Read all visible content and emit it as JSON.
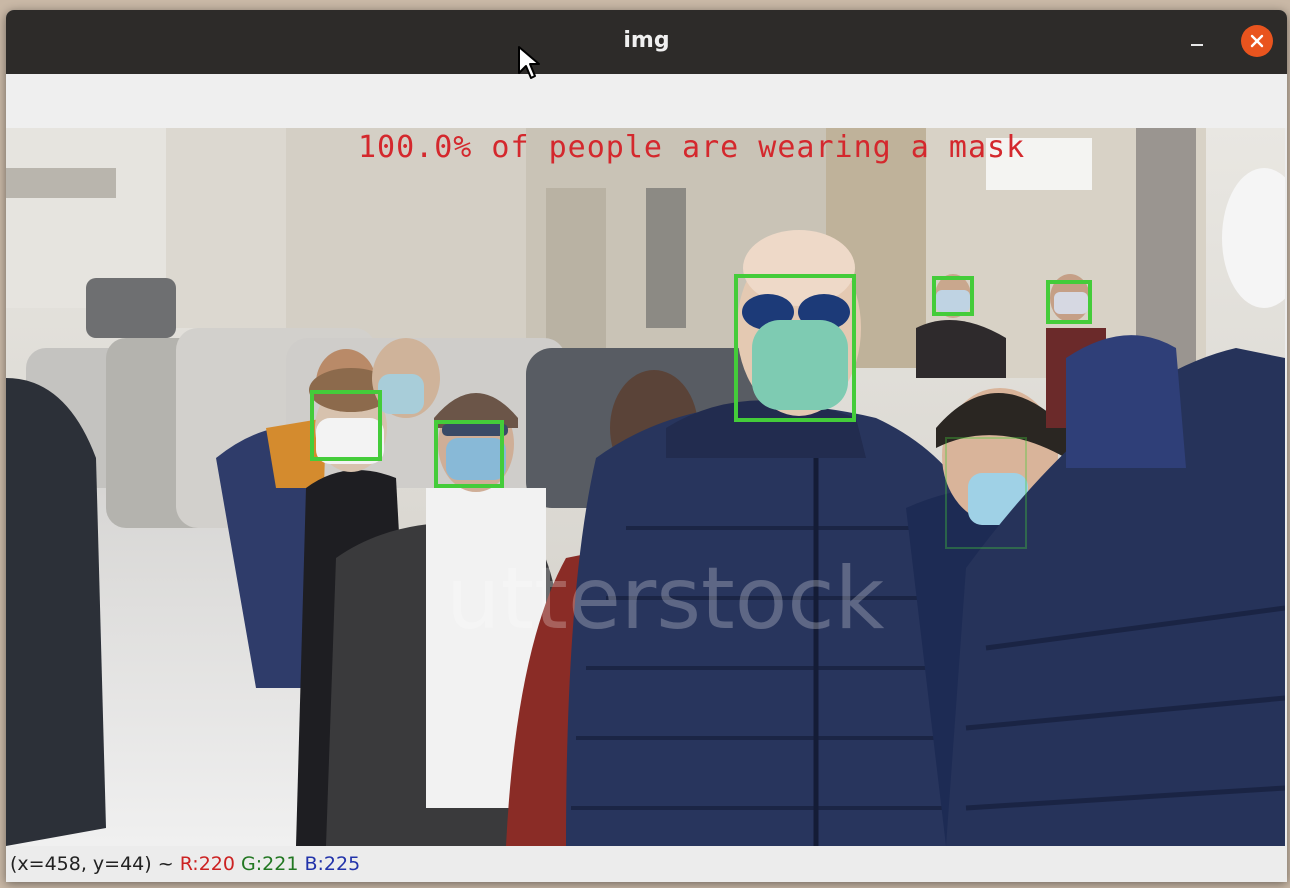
{
  "window": {
    "title": "img"
  },
  "overlay": {
    "text": "100.0% of people are wearing a mask",
    "color": "#d4282d"
  },
  "detections": {
    "box_color": "#44cc3a",
    "count": 6
  },
  "status": {
    "coords": "(x=458, y=44) ~ ",
    "r": "R:220",
    "g": "G:221",
    "b": "B:225",
    "r_color": "#cc2222",
    "g_color": "#227722",
    "b_color": "#2233aa"
  },
  "colors": {
    "titlebar": "#2d2b29",
    "close": "#e9541e"
  },
  "icons": {
    "close": "close-icon",
    "minimize": "minimize-icon",
    "cursor": "mouse-cursor-icon"
  }
}
